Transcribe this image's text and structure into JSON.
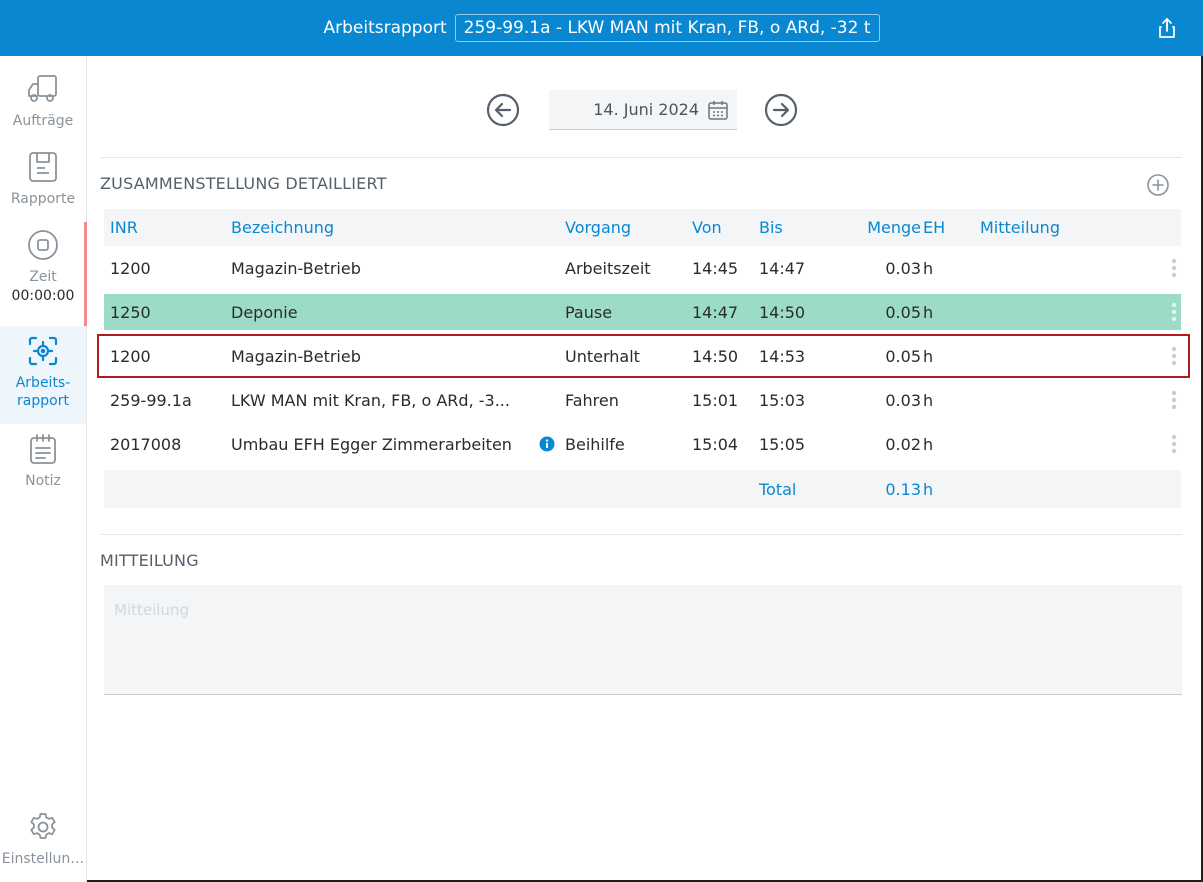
{
  "header": {
    "title": "Arbeitsrapport",
    "job": "259-99.1a - LKW MAN mit Kran, FB, o ARd, -32 t",
    "share_icon": "share-icon"
  },
  "sidebar": {
    "items": [
      {
        "label": "Aufträge",
        "icon": "truck-icon"
      },
      {
        "label": "Rapporte",
        "icon": "report-icon"
      },
      {
        "label": "Zeit",
        "icon": "stop-icon",
        "time": "00:00:00"
      },
      {
        "label": "Arbeits-rapport",
        "icon": "target-icon"
      },
      {
        "label": "Notiz",
        "icon": "notepad-icon"
      }
    ],
    "settings_label": "Einstellun…"
  },
  "date": {
    "value": "14. Juni 2024"
  },
  "section1": {
    "title": "ZUSAMMENSTELLUNG DETAILLIERT"
  },
  "table": {
    "columns": {
      "inr": "INR",
      "bezeichnung": "Bezeichnung",
      "vorgang": "Vorgang",
      "von": "Von",
      "bis": "Bis",
      "menge": "Menge",
      "eh": "EH",
      "mitteilung": "Mitteilung"
    },
    "rows": [
      {
        "inr": "1200",
        "bezeichnung": "Magazin-Betrieb",
        "vorgang": "Arbeitszeit",
        "von": "14:45",
        "bis": "14:47",
        "menge": "0.03",
        "eh": "h"
      },
      {
        "inr": "1250",
        "bezeichnung": "Deponie",
        "vorgang": "Pause",
        "von": "14:47",
        "bis": "14:50",
        "menge": "0.05",
        "eh": "h"
      },
      {
        "inr": "1200",
        "bezeichnung": "Magazin-Betrieb",
        "vorgang": "Unterhalt",
        "von": "14:50",
        "bis": "14:53",
        "menge": "0.05",
        "eh": "h"
      },
      {
        "inr": "259-99.1a",
        "bezeichnung": "LKW MAN mit Kran, FB, o ARd, -3...",
        "vorgang": "Fahren",
        "von": "15:01",
        "bis": "15:03",
        "menge": "0.03",
        "eh": "h"
      },
      {
        "inr": "2017008",
        "bezeichnung": "Umbau EFH Egger Zimmerarbeiten",
        "vorgang": "Beihilfe",
        "von": "15:04",
        "bis": "15:05",
        "menge": "0.02",
        "eh": "h"
      }
    ],
    "total_label": "Total",
    "total_value": "0.13",
    "total_unit": "h"
  },
  "section2": {
    "title": "MITTEILUNG",
    "placeholder": "Mitteilung"
  },
  "colors": {
    "accent": "#0a87d1",
    "highlight_row": "#9bdbc7",
    "selection_border": "#b01c1c"
  }
}
